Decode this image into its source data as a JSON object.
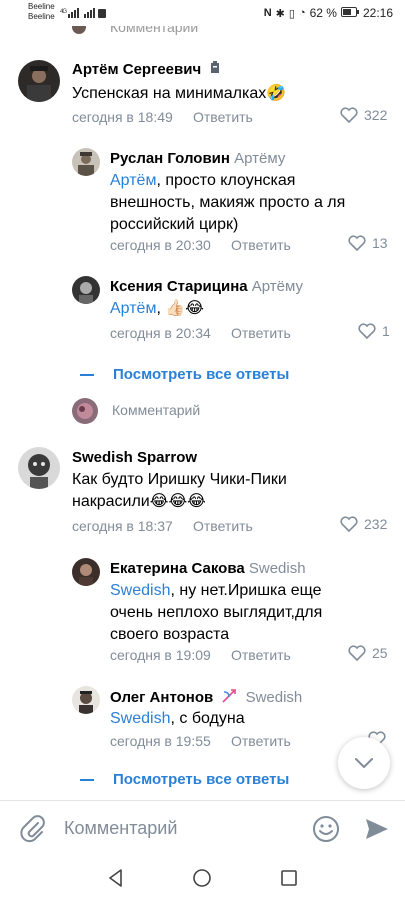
{
  "status": {
    "carrier1": "Beeline",
    "carrier2": "Beeline",
    "net": "4G",
    "battery": "62 %",
    "time": "22:16"
  },
  "prev_text": "Комментарий",
  "comments": [
    {
      "name": "Артём Сергеевич",
      "text": "Успенская на минималках",
      "emoji": "🤣",
      "time": "сегодня в 18:49",
      "reply": "Ответить",
      "likes": "322"
    },
    {
      "name": "Руслан Головин",
      "reply_to": "Артёму",
      "mention": "Артём",
      "text": ", просто клоунская внешность, макияж просто а ля российский цирк)",
      "time": "сегодня в 20:30",
      "reply": "Ответить",
      "likes": "13"
    },
    {
      "name": "Ксения Старицина",
      "reply_to": "Артёму",
      "mention": "Артём",
      "text": ", 👍🏻😂",
      "time": "сегодня в 20:34",
      "reply": "Ответить",
      "likes": "1"
    },
    {
      "name": "Swedish Sparrow",
      "text": "Как будто Иришку Чики-Пики накрасили😂😂😂",
      "time": "сегодня в 18:37",
      "reply": "Ответить",
      "likes": "232"
    },
    {
      "name": "Екатерина Сакова",
      "reply_to": "Swedish",
      "mention": "Swedish",
      "text": ", ну нет.Иришка еще очень неплохо выглядит,для своего возраста",
      "time": "сегодня в 19:09",
      "reply": "Ответить",
      "likes": "25"
    },
    {
      "name": "Олег Антонов",
      "reply_to": "Swedish",
      "mention": "Swedish",
      "text": ", с бодуна",
      "time": "сегодня в 19:55",
      "reply": "Ответить",
      "likes": ""
    }
  ],
  "see_all": "Посмотреть все ответы",
  "comment_placeholder": "Комментарий",
  "composer_placeholder": "Комментарий"
}
